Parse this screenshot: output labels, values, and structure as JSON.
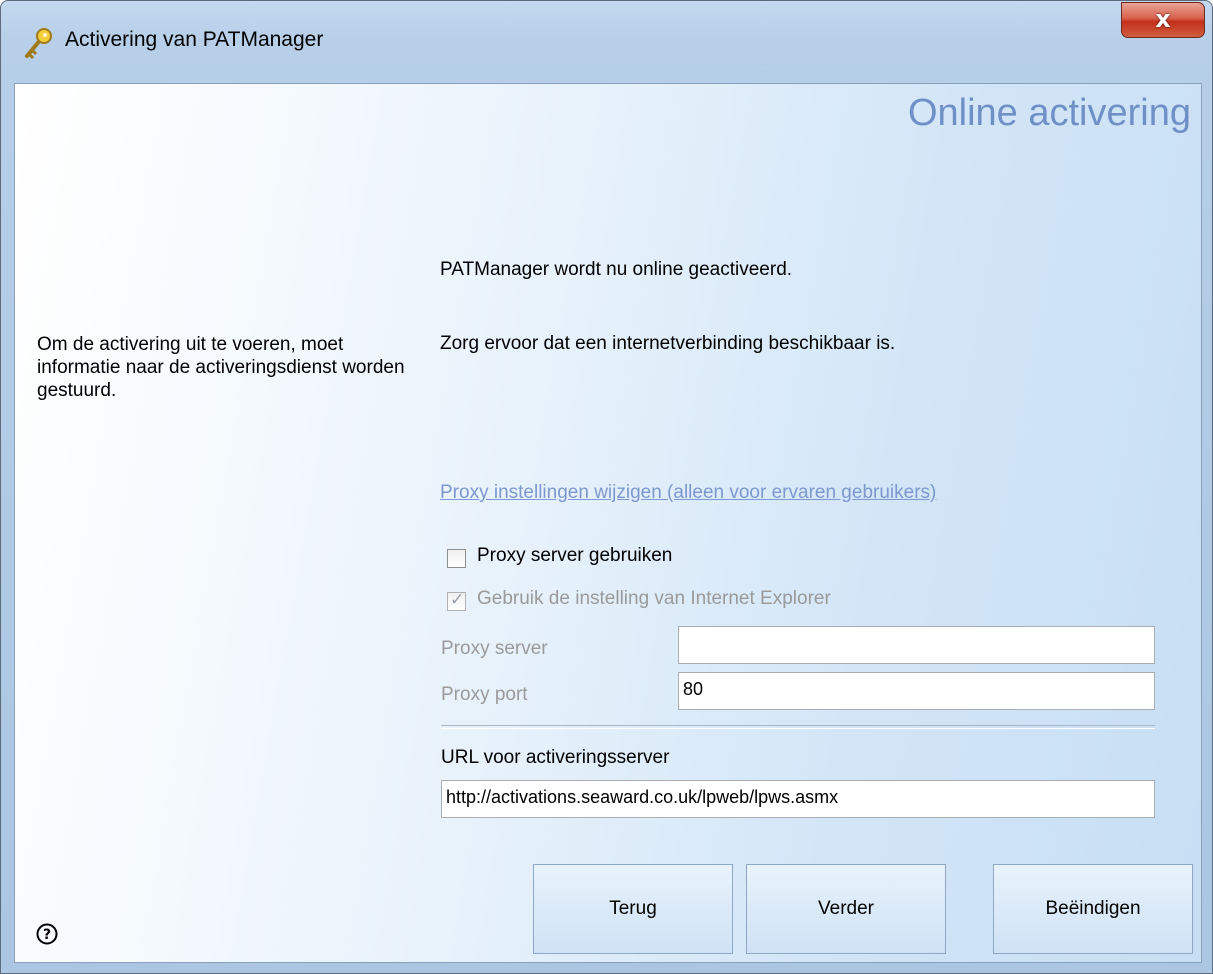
{
  "window": {
    "title": "Activering van PATManager",
    "close_label": "x"
  },
  "page": {
    "heading": "Online activering",
    "left_text": "Om de activering uit te voeren, moet informatie naar de activeringsdienst worden gestuurd.",
    "info_line1": "PATManager wordt nu online geactiveerd.",
    "info_line2": "Zorg ervoor dat een internetverbinding beschikbaar is.",
    "proxy_link": "Proxy instellingen wijzigen (alleen voor ervaren gebruikers)"
  },
  "proxy": {
    "use_proxy_label": "Proxy server gebruiken",
    "use_proxy_checked": false,
    "use_ie_label": "Gebruik de instelling van Internet Explorer",
    "use_ie_checked": true,
    "server_label": "Proxy server",
    "server_value": "",
    "port_label": "Proxy port",
    "port_value": "80"
  },
  "activation": {
    "url_label": "URL voor activeringsserver",
    "url_value": "http://activations.seaward.co.uk/lpweb/lpws.asmx"
  },
  "buttons": {
    "back": "Terug",
    "next": "Verder",
    "finish": "Beëindigen"
  },
  "icons": {
    "title": "key-icon",
    "help": "help-icon",
    "close": "close-icon"
  }
}
